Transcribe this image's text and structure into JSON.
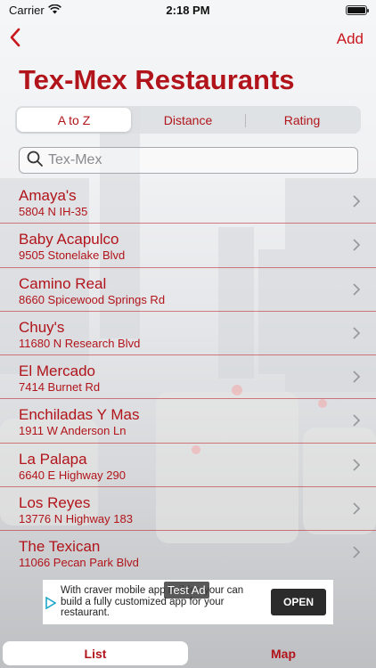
{
  "status_bar": {
    "carrier": "Carrier",
    "time": "2:18 PM",
    "battery_level": 1.0
  },
  "nav": {
    "back_icon": "chevron-left-icon",
    "add_label": "Add"
  },
  "page_title": "Tex-Mex Restaurants",
  "sort_tabs": [
    {
      "label": "A to Z",
      "selected": true
    },
    {
      "label": "Distance",
      "selected": false
    },
    {
      "label": "Rating",
      "selected": false
    }
  ],
  "search": {
    "placeholder": "Tex-Mex",
    "value": ""
  },
  "restaurants": [
    {
      "name": "Amaya's",
      "address": "5804 N IH-35"
    },
    {
      "name": "Baby Acapulco",
      "address": "9505 Stonelake Blvd"
    },
    {
      "name": "Camino Real",
      "address": "8660 Spicewood Springs Rd"
    },
    {
      "name": "Chuy's",
      "address": "11680 N Research Blvd"
    },
    {
      "name": "El Mercado",
      "address": "7414 Burnet Rd"
    },
    {
      "name": "Enchiladas Y Mas",
      "address": "1911 W Anderson Ln"
    },
    {
      "name": "La Palapa",
      "address": "6640 E Highway 290"
    },
    {
      "name": "Los Reyes",
      "address": "13776 N Highway 183"
    },
    {
      "name": "The Texican",
      "address": "11066 Pecan Park Blvd"
    }
  ],
  "ad": {
    "label": "Test Ad",
    "text": "With craver mobile app builder, your can build a fully customized app for your restaurant.",
    "button": "OPEN"
  },
  "bottom_tabs": [
    {
      "label": "List",
      "selected": true
    },
    {
      "label": "Map",
      "selected": false
    }
  ],
  "colors": {
    "accent": "#b1141a",
    "accent_bright": "#c8171d"
  }
}
